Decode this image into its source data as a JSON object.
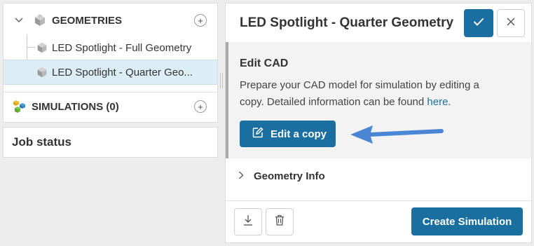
{
  "tree": {
    "geometries_label": "GEOMETRIES",
    "items": [
      {
        "label": "LED Spotlight - Full Geometry"
      },
      {
        "label": "LED Spotlight - Quarter Geo..."
      }
    ],
    "simulations_label": "SIMULATIONS (0)",
    "add_symbol": "+"
  },
  "job_status": {
    "label": "Job status"
  },
  "panel": {
    "title": "LED Spotlight - Quarter Geometry",
    "edit_cad": {
      "title": "Edit CAD",
      "description": "Prepare your CAD model for simulation by editing a copy. Detailed information can be found",
      "link_text": "here",
      "link_suffix": ".",
      "button_label": "Edit a copy"
    },
    "geometry_info_label": "Geometry Info",
    "create_simulation_label": "Create Simulation"
  },
  "icons": {
    "confirm": "check-icon",
    "close": "close-icon",
    "download": "download-icon",
    "delete": "trash-icon",
    "edit": "edit-icon",
    "arrow": "arrow-left-icon"
  },
  "colors": {
    "primary": "#1a6fa0",
    "arrow": "#4a86d4",
    "selected_row": "#dcedf6"
  }
}
